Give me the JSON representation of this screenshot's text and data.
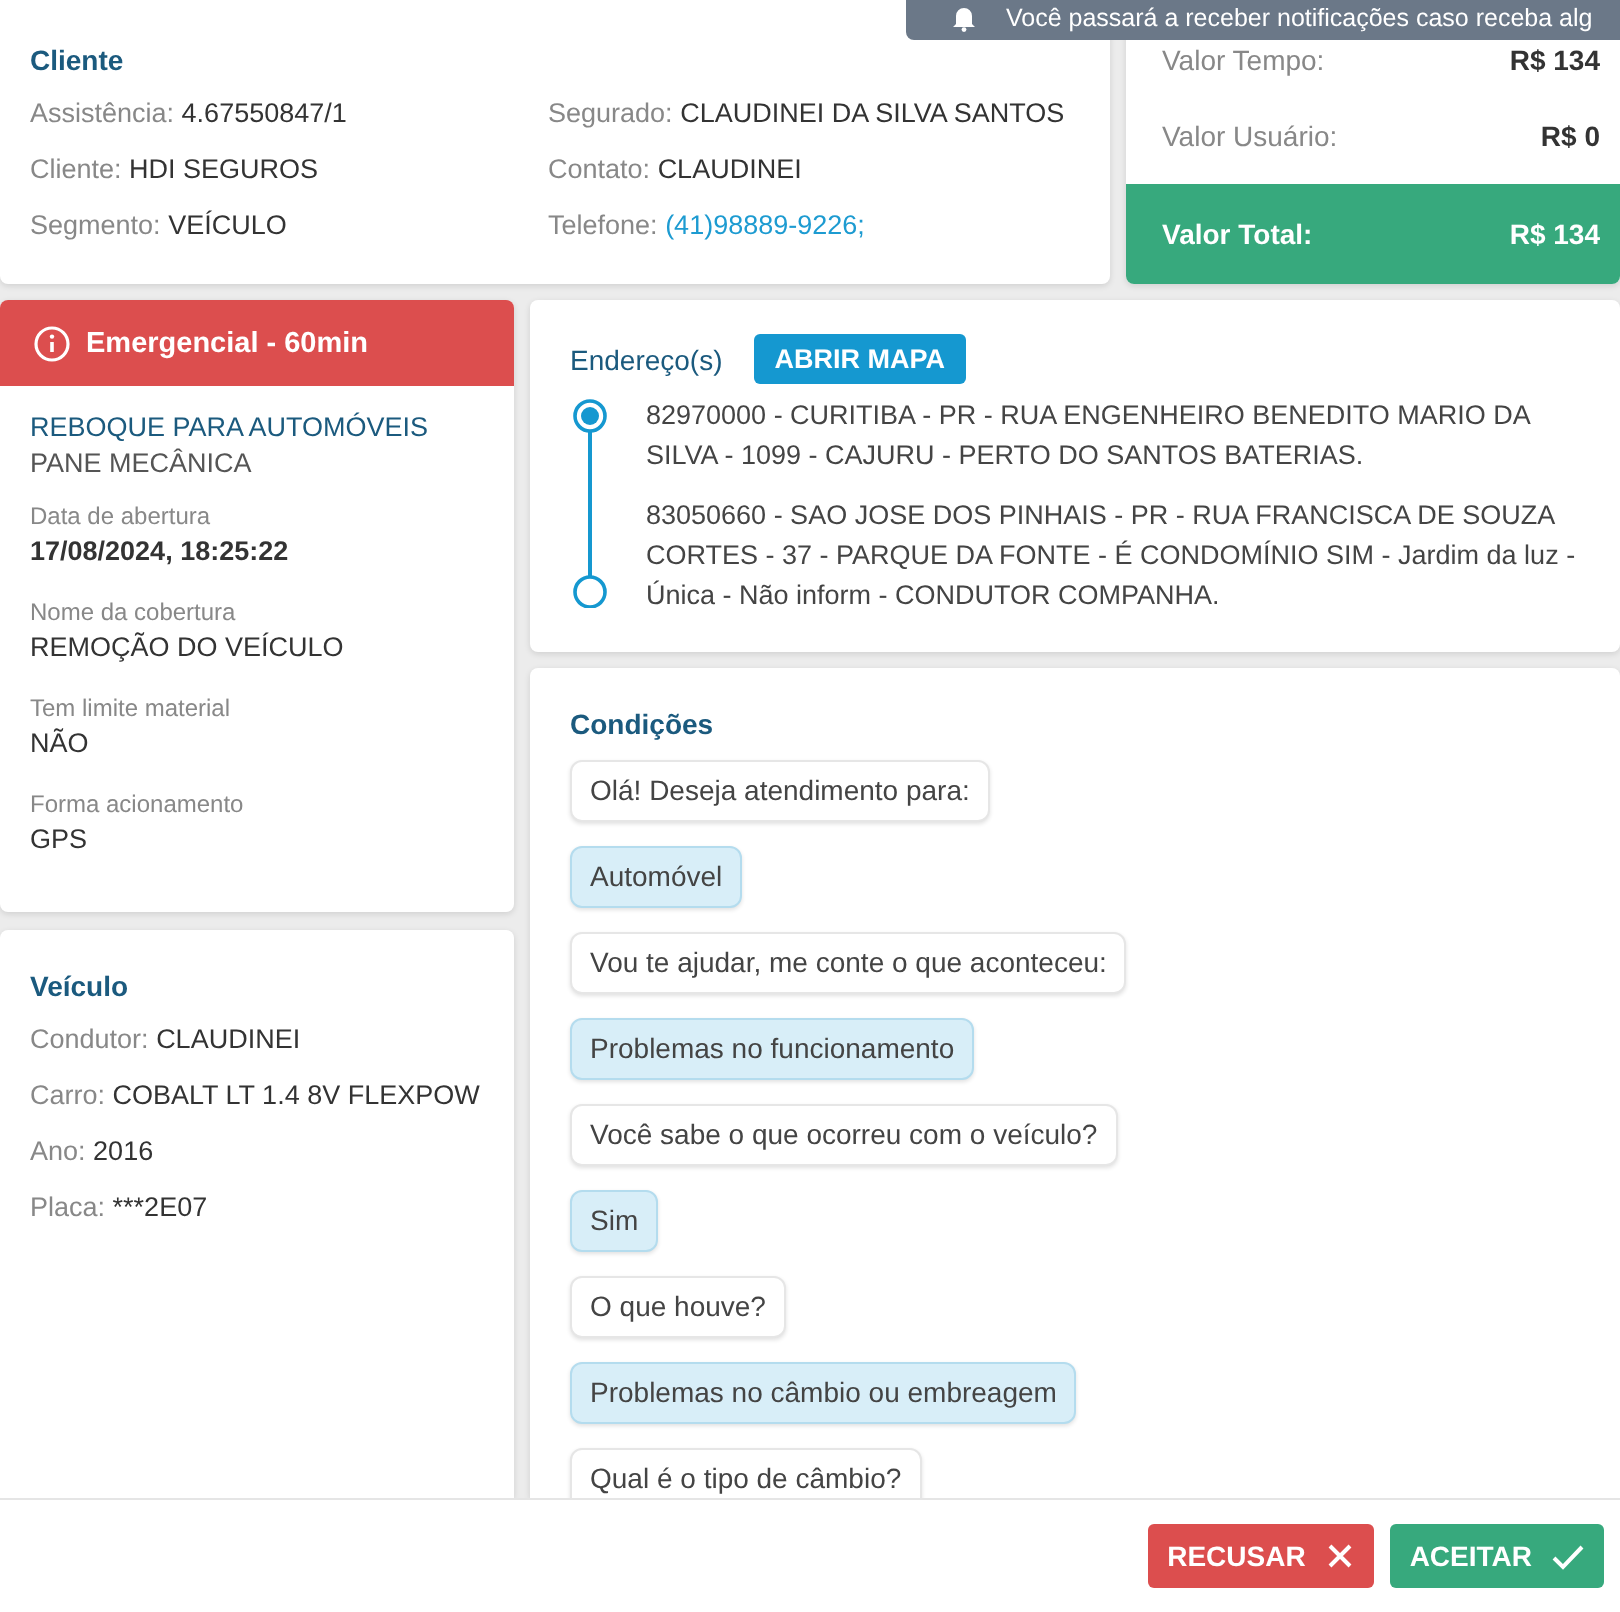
{
  "notification": {
    "text": "Você passará a receber notificações caso receba alg"
  },
  "cliente": {
    "title": "Cliente",
    "columns": [
      [
        {
          "label": "Assistência:",
          "value": "4.67550847/1",
          "kind": "plain"
        },
        {
          "label": "Cliente:",
          "value": "HDI SEGUROS",
          "kind": "plain"
        },
        {
          "label": "Segmento:",
          "value": "VEÍCULO",
          "kind": "plain"
        }
      ],
      [
        {
          "label": "Segurado:",
          "value": "CLAUDINEI DA SILVA SANTOS",
          "kind": "plain"
        },
        {
          "label": "Contato:",
          "value": "CLAUDINEI",
          "kind": "plain"
        },
        {
          "label": "Telefone:",
          "value": "(41)98889-9226;",
          "kind": "link"
        }
      ]
    ]
  },
  "valores": {
    "rows": [
      {
        "label": "Valor Tempo:",
        "value": "R$ 134"
      },
      {
        "label": "Valor Usuário:",
        "value": "R$ 0"
      }
    ],
    "total": {
      "label": "Valor Total:",
      "value": "R$ 134"
    }
  },
  "servico": {
    "badge": "Emergencial - 60min",
    "title": "REBOQUE PARA AUTOMÓVEIS",
    "subtitle": "PANE MECÂNICA",
    "details": [
      {
        "label": "Data de abertura",
        "value": "17/08/2024, 18:25:22"
      },
      {
        "label": "Nome da cobertura",
        "value": "REMOÇÃO DO VEÍCULO"
      },
      {
        "label": "Tem limite material",
        "value": "NÃO"
      },
      {
        "label": "Forma acionamento",
        "value": "GPS"
      }
    ]
  },
  "veiculo": {
    "title": "Veículo",
    "fields": [
      {
        "label": "Condutor:",
        "value": "CLAUDINEI"
      },
      {
        "label": "Carro:",
        "value": "COBALT LT 1.4 8V FLEXPOW"
      },
      {
        "label": "Ano:",
        "value": "2016"
      },
      {
        "label": "Placa:",
        "value": "***2E07"
      }
    ]
  },
  "enderecos": {
    "title": "Endereço(s)",
    "map_button": "ABRIR MAPA",
    "stops": [
      {
        "kind": "origin",
        "text": "82970000 - CURITIBA - PR - RUA ENGENHEIRO BENEDITO MARIO DA SILVA - 1099 - CAJURU - PERTO DO SANTOS BATERIAS."
      },
      {
        "kind": "destination",
        "text": "83050660 - SAO JOSE DOS PINHAIS - PR - RUA FRANCISCA DE SOUZA CORTES - 37 - PARQUE DA FONTE - É CONDOMÍNIO SIM - Jardim da luz - Única - Não inform - CONDUTOR COMPANHA."
      }
    ]
  },
  "condicoes": {
    "title": "Condições",
    "messages": [
      {
        "kind": "question",
        "text": "Olá! Deseja atendimento para:"
      },
      {
        "kind": "answer",
        "text": "Automóvel"
      },
      {
        "kind": "question",
        "text": "Vou te ajudar, me conte o que aconteceu:"
      },
      {
        "kind": "answer",
        "text": "Problemas no funcionamento"
      },
      {
        "kind": "question",
        "text": "Você sabe o que ocorreu com o veículo?"
      },
      {
        "kind": "answer",
        "text": "Sim"
      },
      {
        "kind": "question",
        "text": "O que houve?"
      },
      {
        "kind": "answer",
        "text": "Problemas no câmbio ou embreagem"
      },
      {
        "kind": "question",
        "text": "Qual é o tipo de câmbio?"
      }
    ]
  },
  "actions": [
    {
      "kind": "reject",
      "label": "RECUSAR"
    },
    {
      "kind": "accept",
      "label": "ACEITAR"
    }
  ]
}
